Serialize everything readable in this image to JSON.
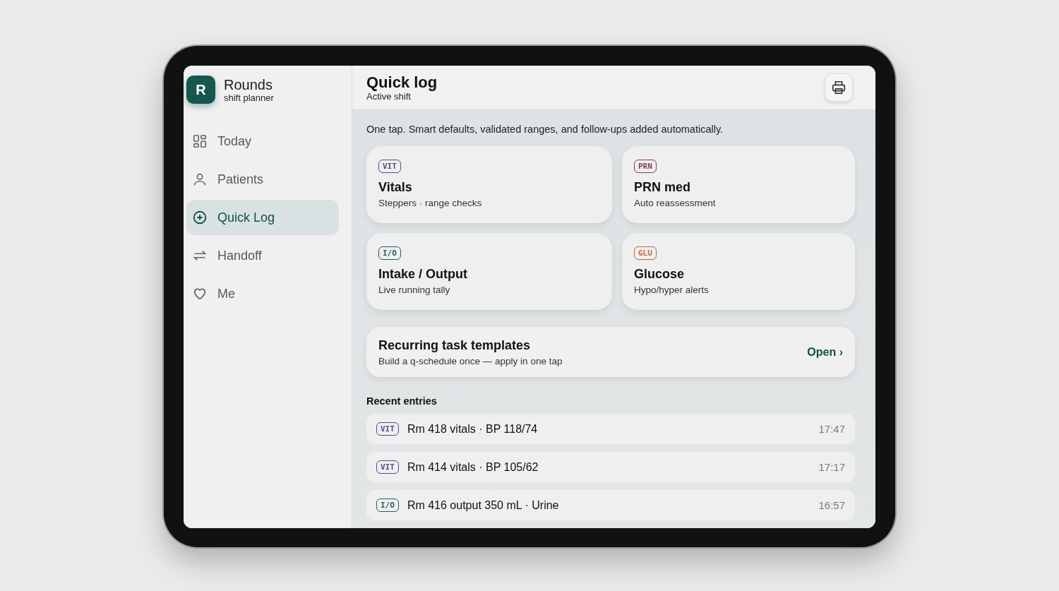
{
  "app": {
    "logo_letter": "R",
    "name": "Rounds",
    "subtitle": "shift planner"
  },
  "nav": [
    {
      "label": "Today",
      "kind": "grid",
      "selected": false
    },
    {
      "label": "Patients",
      "kind": "person",
      "selected": false
    },
    {
      "label": "Quick Log",
      "kind": "plus",
      "selected": true
    },
    {
      "label": "Handoff",
      "kind": "swap",
      "selected": false
    },
    {
      "label": "Me",
      "kind": "heart",
      "selected": false
    }
  ],
  "header": {
    "title": "Quick log",
    "subtitle": "Active shift"
  },
  "intro": "One tap. Smart defaults, validated ranges, and follow-ups added automatically.",
  "log_cards": [
    {
      "tag": "VIT",
      "color": "#5a4a86",
      "title": "Vitals",
      "subtitle": "Steppers · range checks"
    },
    {
      "tag": "PRN",
      "color": "#8c3a4c",
      "title": "PRN med",
      "subtitle": "Auto reassessment"
    },
    {
      "tag": "I/O",
      "color": "#1f5f5a",
      "title": "Intake / Output",
      "subtitle": "Live running tally"
    },
    {
      "tag": "GLU",
      "color": "#c0683c",
      "title": "Glucose",
      "subtitle": "Hypo/hyper alerts"
    }
  ],
  "templates": {
    "title": "Recurring task templates",
    "subtitle": "Build a q-schedule once — apply in one tap",
    "link": "Open ›"
  },
  "recent": {
    "heading": "Recent entries",
    "entries": [
      {
        "tag": "VIT",
        "color": "#5a4a86",
        "text": "Rm 418 vitals · BP 118/74",
        "time": "17:47"
      },
      {
        "tag": "VIT",
        "color": "#5a4a86",
        "text": "Rm 414 vitals · BP 105/62",
        "time": "17:17"
      },
      {
        "tag": "I/O",
        "color": "#1f5f5a",
        "text": "Rm 416 output 350 mL · Urine",
        "time": "16:57"
      }
    ]
  }
}
